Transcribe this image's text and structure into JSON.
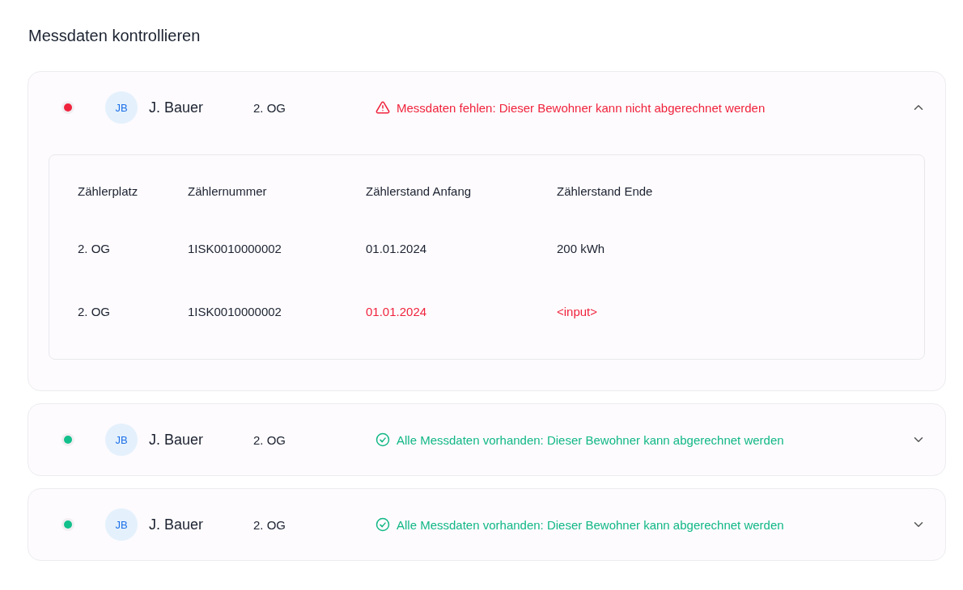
{
  "title": "Messdaten kontrollieren",
  "residents": [
    {
      "initials": "JB",
      "name": "J. Bauer",
      "floor": "2. OG",
      "color": "#f0233c",
      "status": {
        "kind": "missing",
        "text": "Messdaten fehlen: Dieser Bewohner kann nicht abgerechnet werden"
      },
      "expanded": true,
      "table": {
        "columns": [
          "Zählerplatz",
          "Zählernummer",
          "Zählerstand Anfang",
          "Zählerstand  Ende"
        ],
        "rows": [
          [
            {
              "text": "2. OG",
              "error": false
            },
            {
              "text": "1ISK0010000002",
              "error": false
            },
            {
              "text": "01.01.2024",
              "error": false
            },
            {
              "text": "200 kWh",
              "error": false
            }
          ],
          [
            {
              "text": "2. OG",
              "error": false
            },
            {
              "text": "1ISK0010000002",
              "error": false
            },
            {
              "text": "01.01.2024",
              "error": true
            },
            {
              "text": "<input>",
              "error": true
            }
          ]
        ]
      }
    },
    {
      "initials": "JB",
      "name": "J. Bauer",
      "floor": "2. OG",
      "color": "#12c08c",
      "status": {
        "kind": "complete",
        "text": "Alle Messdaten vorhanden: Dieser Bewohner kann abgerechnet werden"
      },
      "expanded": false
    },
    {
      "initials": "JB",
      "name": "J. Bauer",
      "floor": "2. OG",
      "color": "#12c08c",
      "status": {
        "kind": "complete",
        "text": "Alle Messdaten vorhanden: Dieser Bewohner kann abgerechnet werden"
      },
      "expanded": false
    }
  ]
}
